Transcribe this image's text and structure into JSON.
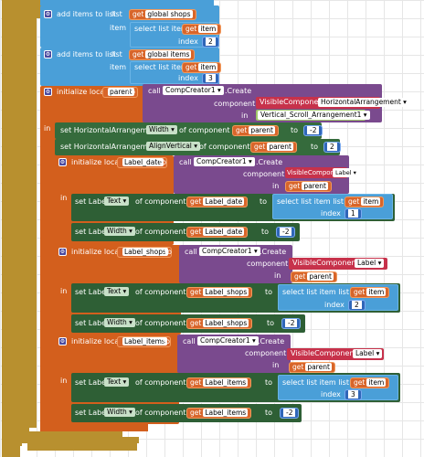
{
  "add1": {
    "prefix": "add items to list",
    "list_kw": "list",
    "item_kw": "item",
    "index_kw": "index",
    "get_kw": "get",
    "global": "global shops",
    "select": "select list item  list",
    "get_item": "item",
    "num": "2"
  },
  "add2": {
    "prefix": "add items to list",
    "list_kw": "list",
    "item_kw": "item",
    "index_kw": "index",
    "get_kw": "get",
    "global": "global items",
    "select": "select list item  list",
    "get_item": "item",
    "num": "3"
  },
  "parent_init": {
    "init": "initialize local",
    "var": "parent",
    "to": "to",
    "in": "in",
    "call": "call",
    "comp": "CompCreator1",
    ".create": ".Create",
    "component_kw": "component",
    "in_kw": "in",
    "visible": "VisibleComponent",
    "type": "HorizontalArrangement",
    "arr": "Vertical_Scroll_Arrangement1"
  },
  "set_width": {
    "set": "set HorizontalArrangement.",
    "prop": "Width",
    "of": "of component",
    "get": "get",
    "var": "parent",
    "to": "to",
    "val": "-2"
  },
  "set_align": {
    "set": "set HorizontalArrangement.",
    "prop": "AlignVertical",
    "of": "of component",
    "get": "get",
    "var": "parent",
    "to": "to",
    "val": "2"
  },
  "date": {
    "init": "initialize local",
    "var": "Label_date",
    "to": "to",
    "call": "call",
    "comp": "CompCreator1",
    ".create": ".Create",
    "component_kw": "component",
    "visible": "VisibleComponent",
    "type": "Label",
    "in_kw": "in",
    "get": "get",
    "parent": "parent",
    "in": "in",
    "set": "set Label.",
    "textprop": "Text",
    "of": "of component",
    "to2": "to",
    "select": "select list item  list",
    "item": "item",
    "index_kw": "index",
    "idx": "1",
    "widthprop": "Width",
    "wval": "-2"
  },
  "shops": {
    "init": "initialize local",
    "var": "Label_shops",
    "to": "to",
    "call": "call",
    "comp": "CompCreator1",
    ".create": ".Create",
    "component_kw": "component",
    "visible": "VisibleComponent",
    "type": "Label",
    "in_kw": "in",
    "get": "get",
    "parent": "parent",
    "in": "in",
    "set": "set Label.",
    "textprop": "Text",
    "of": "of component",
    "to2": "to",
    "select": "select list item  list",
    "item": "item",
    "index_kw": "index",
    "idx": "2",
    "widthprop": "Width",
    "wval": "-2"
  },
  "items": {
    "init": "initialize local",
    "var": "Label_items",
    "to": "to",
    "call": "call",
    "comp": "CompCreator1",
    ".create": ".Create",
    "component_kw": "component",
    "visible": "VisibleComponent",
    "type": "Label",
    "in_kw": "in",
    "get": "get",
    "parent": "parent",
    "in": "in",
    "set": "set Label.",
    "textprop": "Text",
    "of": "of component",
    "to2": "to",
    "select": "select list item  list",
    "item": "item",
    "index_kw": "index",
    "idx": "3",
    "widthprop": "Width",
    "wval": "-2"
  },
  "colors": {
    "olive": "#b8902f",
    "blue": "#4a9fd8",
    "orange": "#d35f1d",
    "purple": "#7a4a8e",
    "green": "#356b3c",
    "pink": "#c7324b"
  }
}
